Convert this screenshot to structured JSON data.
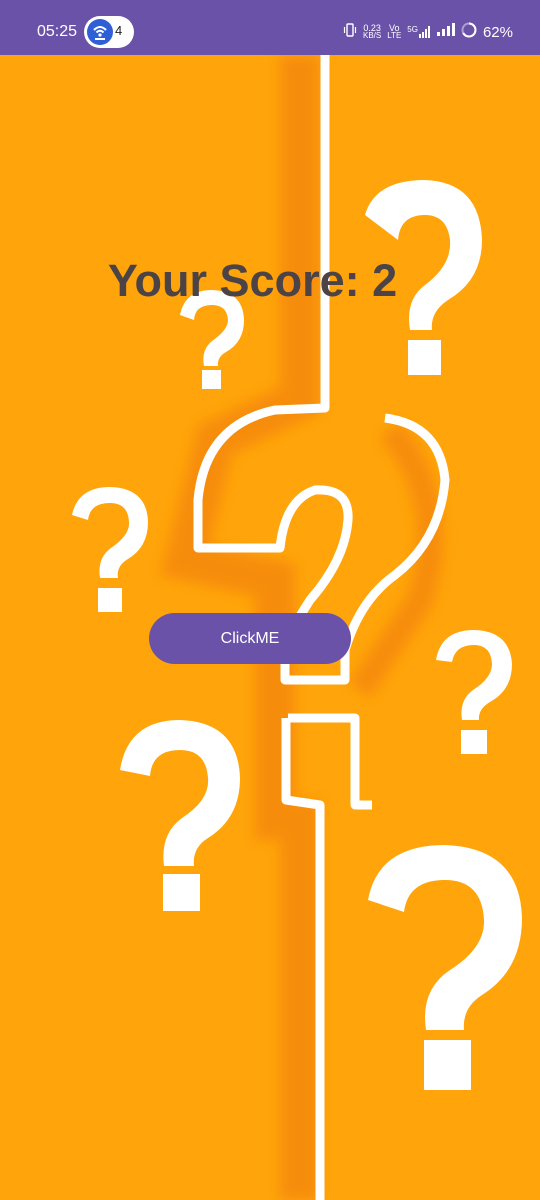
{
  "status_bar": {
    "time": "05:25",
    "hotspot_count": "4",
    "net_speed_value": "0.23",
    "net_speed_unit": "KB/S",
    "volte_top": "Vo",
    "volte_bottom": "LTE",
    "network_type": "5G",
    "battery_percent": "62%"
  },
  "main": {
    "score_text": "Your Score: 2",
    "button_label": "ClickME"
  },
  "colors": {
    "background": "#ffa40a",
    "status_bar": "#6a52a8",
    "button": "#6a52a8",
    "score_text": "#4b4346"
  },
  "background_image": "question-marks-illustration"
}
